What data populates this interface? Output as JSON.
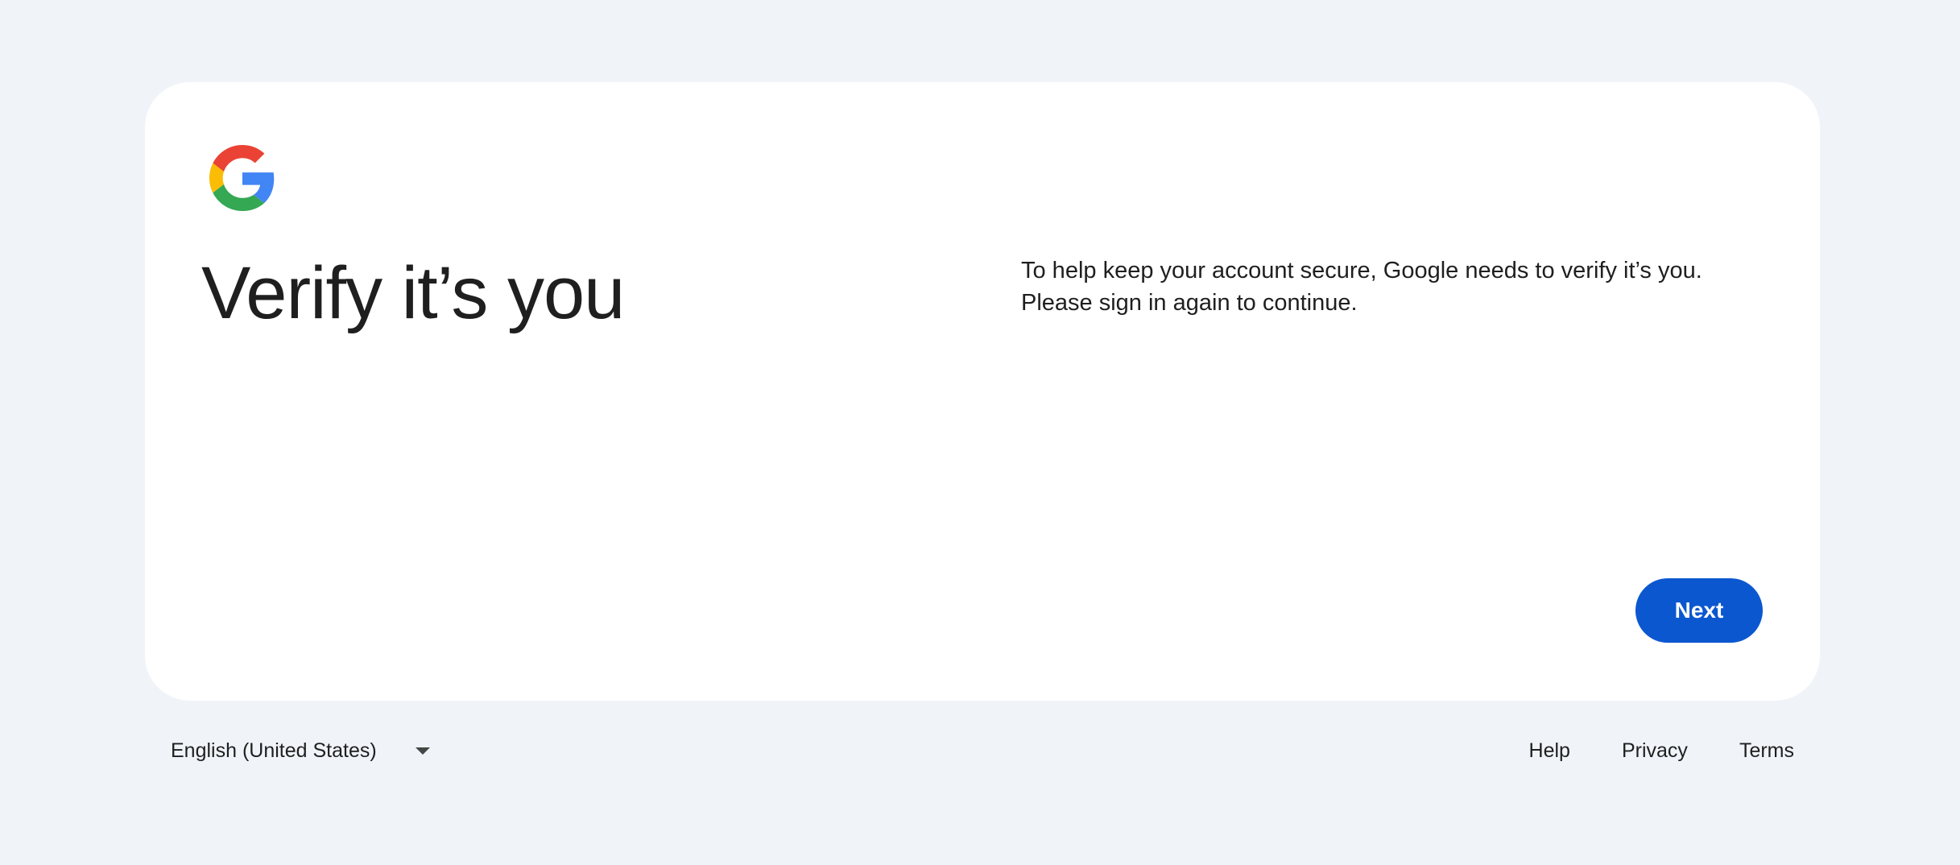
{
  "card": {
    "logo_icon": "google-g-logo",
    "title": "Verify it’s you",
    "description_line1": "To help keep your account secure, Google needs to verify it’s you.",
    "description_line2": "Please sign in again to continue.",
    "next_label": "Next"
  },
  "footer": {
    "language": "English (United States)",
    "language_icon": "caret-down-icon",
    "links": {
      "help": "Help",
      "privacy": "Privacy",
      "terms": "Terms"
    }
  },
  "colors": {
    "page_background": "#f0f4f9",
    "card_background": "#ffffff",
    "primary_button": "#0b57d0",
    "text": "#1f1f1f",
    "google_blue": "#4285F4",
    "google_red": "#EA4335",
    "google_yellow": "#FBBC05",
    "google_green": "#34A853"
  }
}
